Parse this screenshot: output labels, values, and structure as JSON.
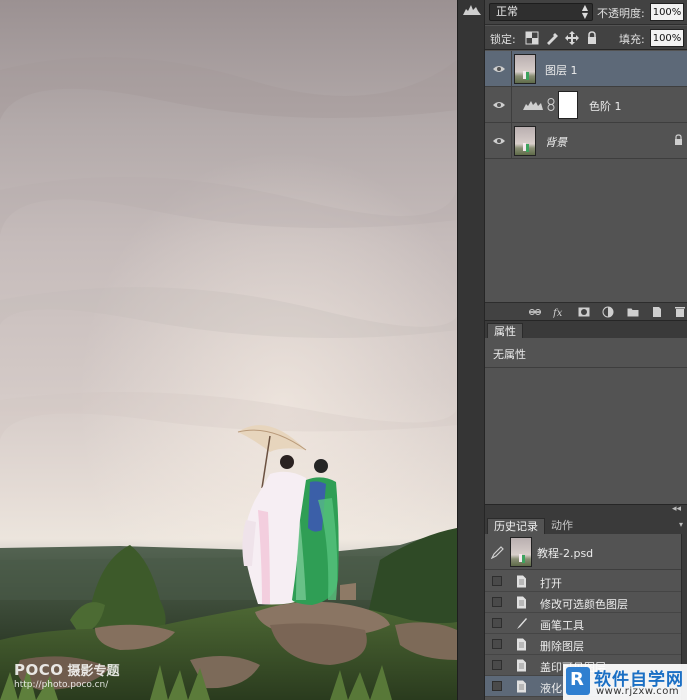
{
  "watermark": {
    "brand": "POCO",
    "title": "摄影专题",
    "url": "http://photo.poco.cn/"
  },
  "layers_panel": {
    "blend_mode": "正常",
    "opacity_label": "不透明度:",
    "opacity_value": "100%",
    "lock_label": "锁定:",
    "fill_label": "填充:",
    "fill_value": "100%",
    "layers": [
      {
        "name": "图层 1",
        "selected": true
      },
      {
        "name": "色阶 1",
        "type": "levels-adjustment"
      },
      {
        "name": "背景",
        "locked": true
      }
    ]
  },
  "properties_panel": {
    "tab": "属性",
    "no_properties": "无属性"
  },
  "history_panel": {
    "tabs": [
      "历史记录",
      "动作"
    ],
    "snapshot": "教程-2.psd",
    "steps": [
      "打开",
      "修改可选颜色图层",
      "画笔工具",
      "删除图层",
      "盖印可见图层",
      "液化"
    ],
    "current_step_index": 5
  },
  "site_logo": {
    "name": "软件自学网",
    "url": "www.rjzxw.com",
    "glyph": "R"
  },
  "colors": {
    "panel_bg": "#535353",
    "selected_row": "#5d6978",
    "dark_bar": "#424242"
  }
}
